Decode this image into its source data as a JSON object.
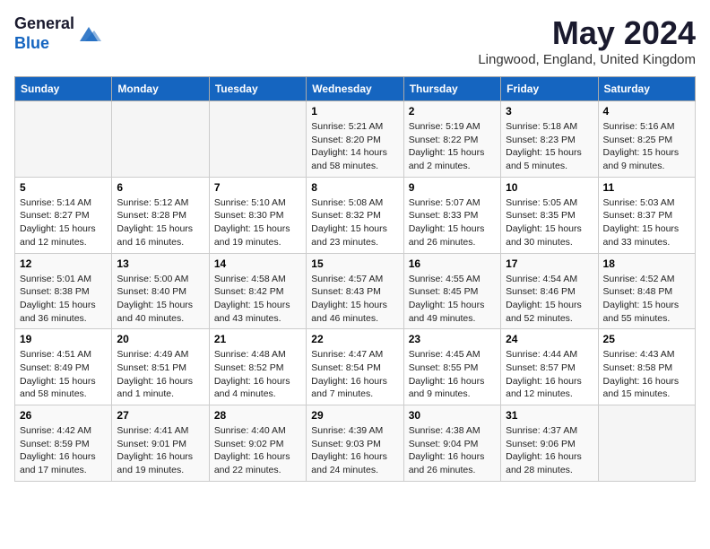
{
  "header": {
    "logo_general": "General",
    "logo_blue": "Blue",
    "month_title": "May 2024",
    "subtitle": "Lingwood, England, United Kingdom"
  },
  "weekdays": [
    "Sunday",
    "Monday",
    "Tuesday",
    "Wednesday",
    "Thursday",
    "Friday",
    "Saturday"
  ],
  "weeks": [
    [
      {
        "day": "",
        "info": ""
      },
      {
        "day": "",
        "info": ""
      },
      {
        "day": "",
        "info": ""
      },
      {
        "day": "1",
        "info": "Sunrise: 5:21 AM\nSunset: 8:20 PM\nDaylight: 14 hours and 58 minutes."
      },
      {
        "day": "2",
        "info": "Sunrise: 5:19 AM\nSunset: 8:22 PM\nDaylight: 15 hours and 2 minutes."
      },
      {
        "day": "3",
        "info": "Sunrise: 5:18 AM\nSunset: 8:23 PM\nDaylight: 15 hours and 5 minutes."
      },
      {
        "day": "4",
        "info": "Sunrise: 5:16 AM\nSunset: 8:25 PM\nDaylight: 15 hours and 9 minutes."
      }
    ],
    [
      {
        "day": "5",
        "info": "Sunrise: 5:14 AM\nSunset: 8:27 PM\nDaylight: 15 hours and 12 minutes."
      },
      {
        "day": "6",
        "info": "Sunrise: 5:12 AM\nSunset: 8:28 PM\nDaylight: 15 hours and 16 minutes."
      },
      {
        "day": "7",
        "info": "Sunrise: 5:10 AM\nSunset: 8:30 PM\nDaylight: 15 hours and 19 minutes."
      },
      {
        "day": "8",
        "info": "Sunrise: 5:08 AM\nSunset: 8:32 PM\nDaylight: 15 hours and 23 minutes."
      },
      {
        "day": "9",
        "info": "Sunrise: 5:07 AM\nSunset: 8:33 PM\nDaylight: 15 hours and 26 minutes."
      },
      {
        "day": "10",
        "info": "Sunrise: 5:05 AM\nSunset: 8:35 PM\nDaylight: 15 hours and 30 minutes."
      },
      {
        "day": "11",
        "info": "Sunrise: 5:03 AM\nSunset: 8:37 PM\nDaylight: 15 hours and 33 minutes."
      }
    ],
    [
      {
        "day": "12",
        "info": "Sunrise: 5:01 AM\nSunset: 8:38 PM\nDaylight: 15 hours and 36 minutes."
      },
      {
        "day": "13",
        "info": "Sunrise: 5:00 AM\nSunset: 8:40 PM\nDaylight: 15 hours and 40 minutes."
      },
      {
        "day": "14",
        "info": "Sunrise: 4:58 AM\nSunset: 8:42 PM\nDaylight: 15 hours and 43 minutes."
      },
      {
        "day": "15",
        "info": "Sunrise: 4:57 AM\nSunset: 8:43 PM\nDaylight: 15 hours and 46 minutes."
      },
      {
        "day": "16",
        "info": "Sunrise: 4:55 AM\nSunset: 8:45 PM\nDaylight: 15 hours and 49 minutes."
      },
      {
        "day": "17",
        "info": "Sunrise: 4:54 AM\nSunset: 8:46 PM\nDaylight: 15 hours and 52 minutes."
      },
      {
        "day": "18",
        "info": "Sunrise: 4:52 AM\nSunset: 8:48 PM\nDaylight: 15 hours and 55 minutes."
      }
    ],
    [
      {
        "day": "19",
        "info": "Sunrise: 4:51 AM\nSunset: 8:49 PM\nDaylight: 15 hours and 58 minutes."
      },
      {
        "day": "20",
        "info": "Sunrise: 4:49 AM\nSunset: 8:51 PM\nDaylight: 16 hours and 1 minute."
      },
      {
        "day": "21",
        "info": "Sunrise: 4:48 AM\nSunset: 8:52 PM\nDaylight: 16 hours and 4 minutes."
      },
      {
        "day": "22",
        "info": "Sunrise: 4:47 AM\nSunset: 8:54 PM\nDaylight: 16 hours and 7 minutes."
      },
      {
        "day": "23",
        "info": "Sunrise: 4:45 AM\nSunset: 8:55 PM\nDaylight: 16 hours and 9 minutes."
      },
      {
        "day": "24",
        "info": "Sunrise: 4:44 AM\nSunset: 8:57 PM\nDaylight: 16 hours and 12 minutes."
      },
      {
        "day": "25",
        "info": "Sunrise: 4:43 AM\nSunset: 8:58 PM\nDaylight: 16 hours and 15 minutes."
      }
    ],
    [
      {
        "day": "26",
        "info": "Sunrise: 4:42 AM\nSunset: 8:59 PM\nDaylight: 16 hours and 17 minutes."
      },
      {
        "day": "27",
        "info": "Sunrise: 4:41 AM\nSunset: 9:01 PM\nDaylight: 16 hours and 19 minutes."
      },
      {
        "day": "28",
        "info": "Sunrise: 4:40 AM\nSunset: 9:02 PM\nDaylight: 16 hours and 22 minutes."
      },
      {
        "day": "29",
        "info": "Sunrise: 4:39 AM\nSunset: 9:03 PM\nDaylight: 16 hours and 24 minutes."
      },
      {
        "day": "30",
        "info": "Sunrise: 4:38 AM\nSunset: 9:04 PM\nDaylight: 16 hours and 26 minutes."
      },
      {
        "day": "31",
        "info": "Sunrise: 4:37 AM\nSunset: 9:06 PM\nDaylight: 16 hours and 28 minutes."
      },
      {
        "day": "",
        "info": ""
      }
    ]
  ]
}
